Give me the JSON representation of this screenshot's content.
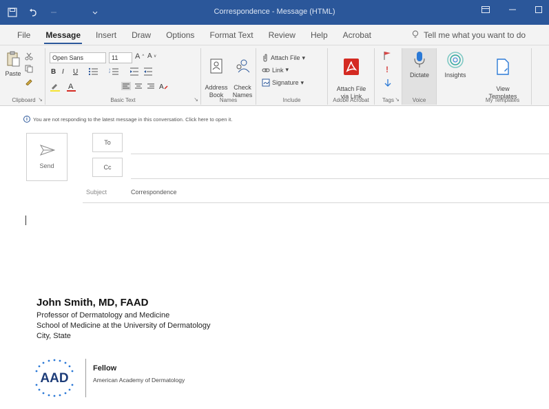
{
  "window": {
    "title": "Correspondence  -  Message (HTML)",
    "titlebar_icons": [
      "save-icon",
      "undo-icon",
      "customize-arrow-icon"
    ],
    "controls": [
      "ribbon-display-icon",
      "minimize-icon",
      "restore-icon"
    ]
  },
  "menu": {
    "tabs": [
      "File",
      "Message",
      "Insert",
      "Draw",
      "Options",
      "Format Text",
      "Review",
      "Help",
      "Acrobat"
    ],
    "active_tab": "Message",
    "tell_me": "Tell me what you want to do"
  },
  "ribbon": {
    "clipboard": {
      "label": "Clipboard",
      "paste": "Paste"
    },
    "basic_text": {
      "label": "Basic Text",
      "font": "Open Sans",
      "size": "11",
      "bold": "B",
      "italic": "I",
      "underline": "U"
    },
    "names": {
      "label": "Names",
      "address_book": "Address\nBook",
      "check_names": "Check\nNames"
    },
    "include": {
      "label": "Include",
      "attach_file": "Attach File",
      "link": "Link",
      "signature": "Signature"
    },
    "adobe": {
      "label": "Adobe Acrobat",
      "attach_via_link": "Attach File\nvia Link"
    },
    "tags": {
      "label": "Tags"
    },
    "voice": {
      "label": "Voice",
      "dictate": "Dictate"
    },
    "insights": {
      "label": "Insights"
    },
    "templates": {
      "label": "My Templates",
      "view_templates": "View\nTemplates"
    }
  },
  "infobar": {
    "text": "You are not responding to the latest message in this conversation. Click here to open it."
  },
  "compose": {
    "send": "Send",
    "to": "To",
    "cc": "Cc",
    "subject_label": "Subject",
    "subject_value": "Correspondence"
  },
  "signature": {
    "name": "John Smith, MD, FAAD",
    "title": "Professor of Dermatology and Medicine",
    "school": "School of Medicine at the University of Dermatology",
    "location": "City, State",
    "logo_text": "AAD",
    "fellow": "Fellow",
    "org": "American Academy of Dermatology"
  },
  "colors": {
    "accent": "#2b579a",
    "acrobat_red": "#d42a22",
    "flag_red": "#d64545",
    "dictate_blue": "#2b79d6"
  }
}
